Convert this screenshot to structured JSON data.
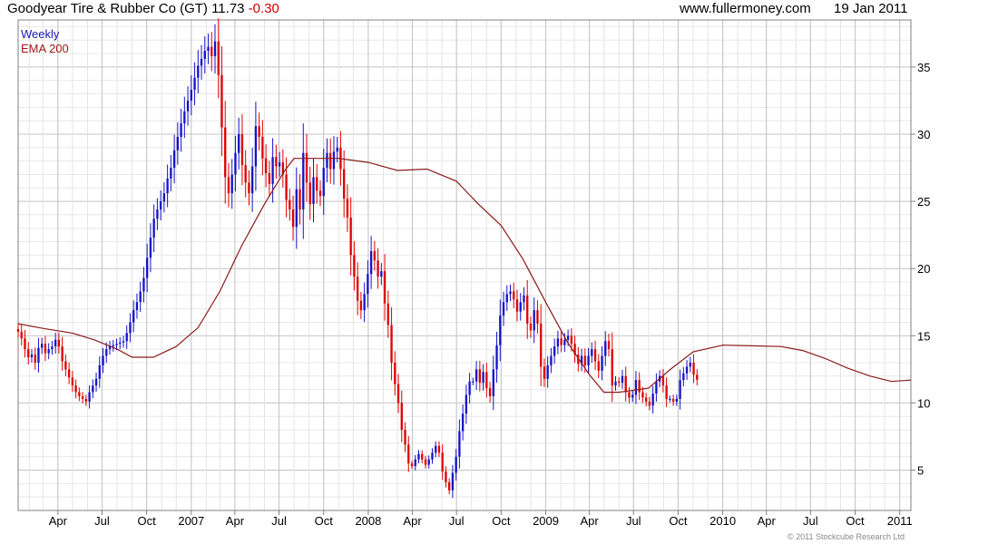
{
  "header": {
    "title": "Goodyear Tire & Rubber Co (GT) 11.73",
    "change": "-0.30",
    "site": "www.fullermoney.com",
    "date": "19 Jan 2011"
  },
  "legend": {
    "weekly": "Weekly",
    "ema": "EMA 200"
  },
  "copyright": "© 2011 Stockcube Research Ltd",
  "colors": {
    "up": "#1414c8",
    "down": "#e00000",
    "ema": "#8b1a1a",
    "grid": "#d4d4d4",
    "frame": "#808080"
  },
  "chart_data": {
    "type": "candlestick",
    "frequency": "weekly",
    "y_axis": {
      "min": 2,
      "max": 38.5,
      "ticks": [
        5,
        10,
        15,
        20,
        25,
        30,
        35
      ],
      "side": "right"
    },
    "x_axis": {
      "start": "2006-01-09",
      "end": "2011-01-24",
      "labels": [
        {
          "date": "2006-04-01",
          "label": "Apr"
        },
        {
          "date": "2006-07-01",
          "label": "Jul"
        },
        {
          "date": "2006-10-01",
          "label": "Oct"
        },
        {
          "date": "2007-01-01",
          "label": "2007"
        },
        {
          "date": "2007-04-01",
          "label": "Apr"
        },
        {
          "date": "2007-07-01",
          "label": "Jul"
        },
        {
          "date": "2007-10-01",
          "label": "Oct"
        },
        {
          "date": "2008-01-01",
          "label": "2008"
        },
        {
          "date": "2008-04-01",
          "label": "Apr"
        },
        {
          "date": "2008-07-01",
          "label": "Jul"
        },
        {
          "date": "2008-10-01",
          "label": "Oct"
        },
        {
          "date": "2009-01-01",
          "label": "2009"
        },
        {
          "date": "2009-04-01",
          "label": "Apr"
        },
        {
          "date": "2009-07-01",
          "label": "Jul"
        },
        {
          "date": "2009-10-01",
          "label": "Oct"
        },
        {
          "date": "2010-01-01",
          "label": "2010"
        },
        {
          "date": "2010-04-01",
          "label": "Apr"
        },
        {
          "date": "2010-07-01",
          "label": "Jul"
        },
        {
          "date": "2010-10-01",
          "label": "Oct"
        },
        {
          "date": "2011-01-01",
          "label": "2011"
        }
      ]
    },
    "grid": true,
    "series": [
      {
        "name": "Weekly",
        "style": "candlestick",
        "dates_from": "2006-01-09",
        "closes": [
          15.3,
          14.8,
          14.0,
          13.4,
          13.6,
          13.0,
          14.1,
          14.4,
          13.7,
          14.0,
          14.2,
          14.7,
          14.2,
          13.1,
          12.5,
          11.9,
          11.3,
          10.8,
          10.5,
          10.3,
          10.1,
          10.8,
          11.3,
          11.8,
          12.8,
          13.5,
          14.0,
          14.2,
          14.3,
          14.4,
          14.5,
          14.6,
          15.2,
          16.0,
          16.9,
          17.5,
          18.3,
          19.3,
          20.8,
          22.3,
          23.7,
          24.4,
          25.0,
          25.6,
          26.7,
          27.5,
          28.8,
          29.8,
          30.8,
          31.7,
          32.5,
          33.3,
          34.2,
          35.1,
          35.6,
          36.2,
          36.5,
          35.8,
          36.9,
          34.4,
          30.5,
          26.8,
          25.6,
          27.0,
          28.6,
          30.0,
          27.7,
          26.4,
          25.6,
          27.6,
          30.6,
          29.8,
          28.2,
          27.1,
          26.3,
          28.3,
          27.6,
          27.9,
          27.0,
          25.1,
          24.4,
          23.1,
          25.9,
          24.4,
          28.6,
          26.4,
          24.8,
          26.8,
          25.8,
          25.4,
          27.5,
          28.6,
          27.4,
          28.7,
          29.0,
          27.4,
          25.2,
          23.8,
          21.0,
          19.4,
          17.6,
          16.9,
          18.1,
          19.6,
          21.3,
          20.6,
          19.4,
          19.8,
          17.4,
          15.8,
          13.0,
          11.4,
          10.0,
          8.0,
          6.9,
          5.5,
          5.3,
          5.8,
          6.2,
          5.8,
          5.4,
          5.8,
          6.3,
          6.8,
          6.3,
          4.9,
          4.1,
          3.5,
          4.8,
          6.0,
          7.9,
          9.2,
          10.6,
          11.6,
          11.6,
          12.5,
          11.5,
          12.3,
          11.1,
          10.5,
          12.5,
          14.3,
          16.5,
          17.5,
          18.1,
          18.3,
          17.7,
          16.8,
          17.5,
          18.0,
          15.9,
          15.4,
          16.9,
          15.9,
          12.7,
          11.8,
          12.8,
          13.5,
          14.2,
          14.8,
          14.3,
          14.7,
          15.0,
          14.4,
          13.6,
          12.9,
          13.5,
          12.8,
          13.5,
          14.0,
          13.1,
          12.4,
          13.5,
          14.6,
          14.0,
          11.3,
          11.6,
          11.5,
          12.0,
          10.8,
          10.4,
          10.6,
          11.7,
          10.8,
          10.4,
          10.1,
          9.8,
          10.7,
          11.6,
          12.0,
          11.3,
          10.3,
          10.3,
          10.1,
          10.3,
          11.7,
          12.2,
          12.7,
          13.0,
          12.1,
          11.73
        ]
      },
      {
        "name": "EMA 200",
        "style": "line",
        "points": [
          {
            "date": "2006-01-09",
            "value": 15.9
          },
          {
            "date": "2006-03-01",
            "value": 15.55
          },
          {
            "date": "2006-05-01",
            "value": 15.2
          },
          {
            "date": "2006-06-15",
            "value": 14.7
          },
          {
            "date": "2006-08-01",
            "value": 14.0
          },
          {
            "date": "2006-09-01",
            "value": 13.4
          },
          {
            "date": "2006-10-15",
            "value": 13.4
          },
          {
            "date": "2006-12-01",
            "value": 14.2
          },
          {
            "date": "2007-01-15",
            "value": 15.6
          },
          {
            "date": "2007-03-01",
            "value": 18.3
          },
          {
            "date": "2007-04-15",
            "value": 21.7
          },
          {
            "date": "2007-06-01",
            "value": 24.8
          },
          {
            "date": "2007-07-15",
            "value": 27.4
          },
          {
            "date": "2007-08-01",
            "value": 28.2
          },
          {
            "date": "2007-09-01",
            "value": 28.2
          },
          {
            "date": "2007-11-01",
            "value": 28.2
          },
          {
            "date": "2008-01-01",
            "value": 27.9
          },
          {
            "date": "2008-03-01",
            "value": 27.3
          },
          {
            "date": "2008-05-01",
            "value": 27.4
          },
          {
            "date": "2008-07-01",
            "value": 26.5
          },
          {
            "date": "2008-08-15",
            "value": 24.8
          },
          {
            "date": "2008-10-01",
            "value": 23.2
          },
          {
            "date": "2008-11-15",
            "value": 20.7
          },
          {
            "date": "2009-01-01",
            "value": 17.5
          },
          {
            "date": "2009-02-15",
            "value": 14.5
          },
          {
            "date": "2009-04-01",
            "value": 12.1
          },
          {
            "date": "2009-05-01",
            "value": 10.8
          },
          {
            "date": "2009-06-01",
            "value": 10.8
          },
          {
            "date": "2009-08-01",
            "value": 11.1
          },
          {
            "date": "2009-09-15",
            "value": 12.5
          },
          {
            "date": "2009-11-01",
            "value": 13.8
          },
          {
            "date": "2010-01-01",
            "value": 14.3
          },
          {
            "date": "2010-03-01",
            "value": 14.25
          },
          {
            "date": "2010-05-01",
            "value": 14.2
          },
          {
            "date": "2010-06-15",
            "value": 13.9
          },
          {
            "date": "2010-08-01",
            "value": 13.3
          },
          {
            "date": "2010-09-15",
            "value": 12.6
          },
          {
            "date": "2010-11-01",
            "value": 12.0
          },
          {
            "date": "2010-12-15",
            "value": 11.6
          },
          {
            "date": "2011-01-24",
            "value": 11.7
          }
        ]
      }
    ]
  }
}
